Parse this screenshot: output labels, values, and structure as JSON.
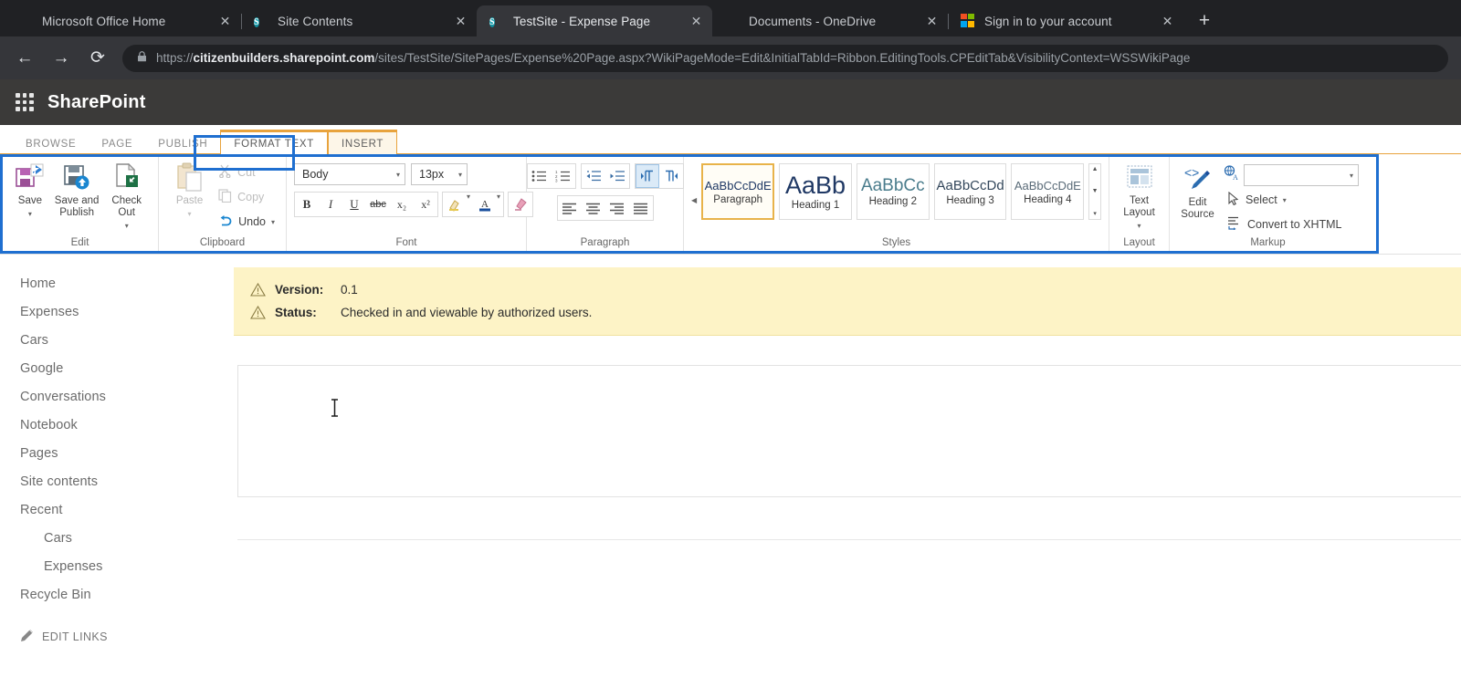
{
  "browser": {
    "tabs": [
      {
        "title": "Microsoft Office Home",
        "favicon": "office-icon",
        "active": false,
        "close": "✕"
      },
      {
        "title": "Site Contents",
        "favicon": "sharepoint-icon",
        "active": false,
        "close": "✕"
      },
      {
        "title": "TestSite - Expense Page",
        "favicon": "sharepoint-icon",
        "active": true,
        "close": "✕"
      },
      {
        "title": "Documents - OneDrive",
        "favicon": "onedrive-icon",
        "active": false,
        "close": "✕"
      },
      {
        "title": "Sign in to your account",
        "favicon": "microsoft-icon",
        "active": false,
        "close": "✕"
      }
    ],
    "new_tab_label": "+",
    "back_label": "←",
    "forward_label": "→",
    "reload_label": "⟳",
    "lock_label": "🔒",
    "url": {
      "scheme": "https://",
      "host": "citizenbuilders.sharepoint.com",
      "path": "/sites/TestSite/SitePages/Expense%20Page.aspx?WikiPageMode=Edit&InitialTabId=Ribbon.EditingTools.CPEditTab&VisibilityContext=WSSWikiPage"
    }
  },
  "suitebar": {
    "waffle": "app-launcher-icon",
    "brand": "SharePoint"
  },
  "ribbon": {
    "tabs": [
      {
        "label": "BROWSE",
        "state": "normal"
      },
      {
        "label": "PAGE",
        "state": "normal"
      },
      {
        "label": "PUBLISH",
        "state": "normal"
      },
      {
        "label": "FORMAT TEXT",
        "state": "active"
      },
      {
        "label": "INSERT",
        "state": "insert"
      }
    ],
    "groups": {
      "edit": {
        "label": "Edit",
        "buttons": [
          {
            "label": "Save",
            "icon": "save-icon",
            "caret": "▾"
          },
          {
            "label": "Save and Publish",
            "icon": "save-publish-icon",
            "caret": ""
          },
          {
            "label": "Check Out",
            "icon": "check-out-icon",
            "caret": "▾"
          }
        ]
      },
      "clipboard": {
        "label": "Clipboard",
        "paste": {
          "label": "Paste",
          "icon": "paste-icon",
          "caret": "▾"
        },
        "items": [
          {
            "label": "Cut",
            "icon": "scissors-icon",
            "disabled": true
          },
          {
            "label": "Copy",
            "icon": "copy-icon",
            "disabled": true
          },
          {
            "label": "Undo",
            "icon": "undo-icon",
            "disabled": false,
            "caret": "▾"
          }
        ]
      },
      "font": {
        "label": "Font",
        "family_value": "Body",
        "size_value": "13px",
        "buttons": [
          {
            "label": "B",
            "name": "bold-icon"
          },
          {
            "label": "I",
            "name": "italic-icon"
          },
          {
            "label": "U",
            "name": "underline-icon"
          },
          {
            "label": "abc",
            "name": "strikethrough-icon"
          },
          {
            "label": "x₂",
            "name": "subscript-icon"
          },
          {
            "label": "x²",
            "name": "superscript-icon"
          },
          {
            "label": "highlight",
            "name": "text-highlight-icon"
          },
          {
            "label": "A",
            "name": "font-color-icon"
          },
          {
            "label": "clear",
            "name": "clear-formatting-icon"
          }
        ]
      },
      "paragraph": {
        "label": "Paragraph",
        "row1": [
          {
            "name": "bulleted-list-icon"
          },
          {
            "name": "numbered-list-icon"
          },
          {
            "name": "decrease-indent-icon"
          },
          {
            "name": "increase-indent-icon"
          },
          {
            "name": "ltr-direction-icon",
            "selected": true
          },
          {
            "name": "rtl-direction-icon",
            "selected": false
          }
        ],
        "row2": [
          {
            "name": "align-left-icon"
          },
          {
            "name": "align-center-icon"
          },
          {
            "name": "align-right-icon"
          },
          {
            "name": "align-justify-icon"
          }
        ]
      },
      "styles": {
        "label": "Styles",
        "cards": [
          {
            "sample": "AaBbCcDdE",
            "name": "Paragraph",
            "size": 13,
            "selected": true
          },
          {
            "sample": "AaBb",
            "name": "Heading 1",
            "size": 27,
            "selected": false
          },
          {
            "sample": "AaBbCc",
            "name": "Heading 2",
            "size": 19,
            "selected": false
          },
          {
            "sample": "AaBbCcDd",
            "name": "Heading 3",
            "size": 15,
            "selected": false
          },
          {
            "sample": "AaBbCcDdE",
            "name": "Heading 4",
            "size": 13,
            "selected": false
          }
        ],
        "scroll_up": "▲",
        "scroll_down": "▼",
        "scroll_more": "▾"
      },
      "layout": {
        "label": "Layout",
        "button": {
          "label": "Text Layout",
          "icon": "text-layout-icon",
          "caret": "▾"
        }
      },
      "markup": {
        "label": "Markup",
        "edit_source": {
          "label": "Edit Source",
          "icon": "edit-source-icon"
        },
        "language_box_value": "",
        "language_icon": "language-icon",
        "items": [
          {
            "label": "Select",
            "icon": "select-cursor-icon",
            "caret": "▾"
          },
          {
            "label": "Convert to XHTML",
            "icon": "convert-xhtml-icon",
            "caret": ""
          }
        ]
      }
    }
  },
  "leftnav": {
    "items": [
      {
        "label": "Home",
        "sub": false
      },
      {
        "label": "Expenses",
        "sub": false
      },
      {
        "label": "Cars",
        "sub": false
      },
      {
        "label": "Google",
        "sub": false
      },
      {
        "label": "Conversations",
        "sub": false
      },
      {
        "label": "Notebook",
        "sub": false
      },
      {
        "label": "Pages",
        "sub": false
      },
      {
        "label": "Site contents",
        "sub": false
      },
      {
        "label": "Recent",
        "sub": false
      },
      {
        "label": "Cars",
        "sub": true
      },
      {
        "label": "Expenses",
        "sub": true
      },
      {
        "label": "Recycle Bin",
        "sub": false
      }
    ],
    "edit_links": {
      "label": "EDIT LINKS",
      "icon": "pencil-icon"
    }
  },
  "notice": {
    "rows": [
      {
        "icon": "warning-icon",
        "label": "Version:",
        "value": "0.1"
      },
      {
        "icon": "warning-icon",
        "label": "Status:",
        "value": "Checked in and viewable by authorized users."
      }
    ]
  },
  "editor": {
    "cursor": "text-cursor-icon"
  },
  "colors": {
    "annotation_blue": "#1f6fd0",
    "ribbon_accent_orange": "#e8a33d",
    "notice_yellow": "#fdf3c6",
    "suitebar": "#3b3a39",
    "browser_tabstrip": "#202124",
    "browser_toolbar": "#35363a",
    "style_sample_blue": "#1f3864"
  }
}
